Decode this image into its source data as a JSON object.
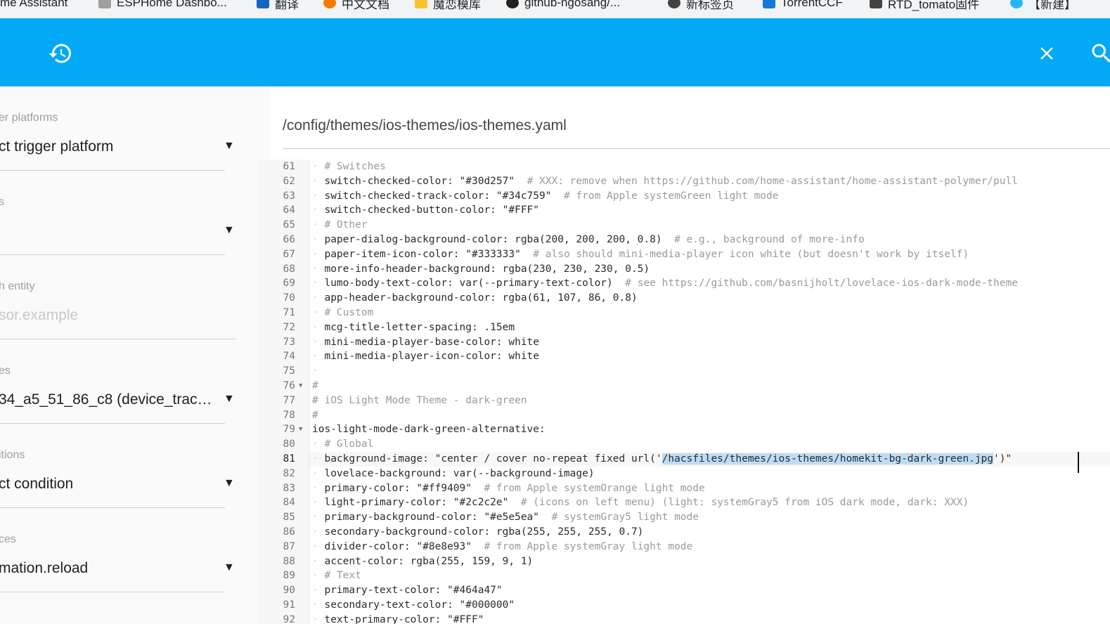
{
  "bookmarks": [
    {
      "label": "me Assistant",
      "color": "#03a9f4"
    },
    {
      "label": "ESPHome Dashbo...",
      "color": "#9e9e9e"
    },
    {
      "label": "翻译",
      "color": "#1565c0"
    },
    {
      "label": "中文文档",
      "color": "#f57c00"
    },
    {
      "label": "魔恋模库",
      "color": "#fbc02d"
    },
    {
      "label": "github-ngosang/...",
      "color": "#212121"
    },
    {
      "label": "新标签页",
      "color": "#424242"
    },
    {
      "label": "TorrentCCF",
      "color": "#1976d2"
    },
    {
      "label": "RTD_tomato固件",
      "color": "#424242"
    },
    {
      "label": "【新建】",
      "color": "#29b6f6"
    }
  ],
  "toolbar": {
    "color": "#03a9f4",
    "left_icon": "history-icon",
    "close_icon": "close-icon",
    "search_icon": "search-icon"
  },
  "form": {
    "fields": [
      {
        "label": "er platforms",
        "value": "ct trigger platform",
        "dropdown": true
      },
      {
        "label": "s",
        "value": "",
        "dropdown": true
      },
      {
        "label": "h entity",
        "value": "sor.example",
        "dropdown": false,
        "placeholder": true
      },
      {
        "label": "es",
        "value": "34_a5_51_86_c8 (device_tracke...",
        "dropdown": true
      },
      {
        "label": "itions",
        "value": "ct condition",
        "dropdown": true
      },
      {
        "label": "ces",
        "value": "mation.reload",
        "dropdown": true
      }
    ]
  },
  "editor": {
    "file_path": "/config/themes/ios-themes/ios-themes.yaml",
    "active_line": "81",
    "lines": [
      {
        "n": "61",
        "indent": 1,
        "text": "# Switches",
        "comment": true
      },
      {
        "n": "62",
        "indent": 1,
        "text": "switch-checked-color: \"#30d257\"",
        "tail": "# XXX: remove when https://github.com/home-assistant/home-assistant-polymer/pull"
      },
      {
        "n": "63",
        "indent": 1,
        "text": "switch-checked-track-color: \"#34c759\"",
        "tail": "# from Apple systemGreen light mode"
      },
      {
        "n": "64",
        "indent": 1,
        "text": "switch-checked-button-color: \"#FFF\""
      },
      {
        "n": "65",
        "indent": 1,
        "text": "# Other",
        "comment": true
      },
      {
        "n": "66",
        "indent": 1,
        "text": "paper-dialog-background-color: rgba(200, 200, 200, 0.8)",
        "tail": "# e.g., background of more-info"
      },
      {
        "n": "67",
        "indent": 1,
        "text": "paper-item-icon-color: \"#333333\"",
        "tail": "# also should mini-media-player icon white (but doesn't work by itself)"
      },
      {
        "n": "68",
        "indent": 1,
        "text": "more-info-header-background: rgba(230, 230, 230, 0.5)"
      },
      {
        "n": "69",
        "indent": 1,
        "text": "lumo-body-text-color: var(--primary-text-color)",
        "tail": "# see https://github.com/basnijholt/lovelace-ios-dark-mode-theme"
      },
      {
        "n": "70",
        "indent": 1,
        "text": "app-header-background-color: rgba(61, 107, 86, 0.8)"
      },
      {
        "n": "71",
        "indent": 1,
        "text": "# Custom",
        "comment": true
      },
      {
        "n": "72",
        "indent": 1,
        "text": "mcg-title-letter-spacing: .15em"
      },
      {
        "n": "73",
        "indent": 1,
        "text": "mini-media-player-base-color: white"
      },
      {
        "n": "74",
        "indent": 1,
        "text": "mini-media-player-icon-color: white"
      },
      {
        "n": "75",
        "indent": 1,
        "text": ""
      },
      {
        "n": "76",
        "indent": 0,
        "text": "#",
        "comment": true,
        "fold": true
      },
      {
        "n": "77",
        "indent": 0,
        "text": "# iOS Light Mode Theme - dark-green",
        "comment": true
      },
      {
        "n": "78",
        "indent": 0,
        "text": "#",
        "comment": true
      },
      {
        "n": "79",
        "indent": 0,
        "text": "ios-light-mode-dark-green-alternative:",
        "fold": true
      },
      {
        "n": "80",
        "indent": 1,
        "text": "# Global",
        "comment": true
      },
      {
        "n": "81",
        "indent": 1,
        "text": "background-image: \"center / cover no-repeat fixed url('",
        "selected": "/hacsfiles/themes/ios-themes/homekit-bg-dark-green.jpg",
        "after": "')\""
      },
      {
        "n": "82",
        "indent": 1,
        "text": "lovelace-background: var(--background-image)"
      },
      {
        "n": "83",
        "indent": 1,
        "text": "primary-color: \"#ff9409\"",
        "tail": "# from Apple systemOrange light mode"
      },
      {
        "n": "84",
        "indent": 1,
        "text": "light-primary-color: \"#2c2c2e\"",
        "tail": "# (icons on left menu) (light: systemGray5 from iOS dark mode, dark: XXX)"
      },
      {
        "n": "85",
        "indent": 1,
        "text": "primary-background-color: \"#e5e5ea\"",
        "tail": "# systemGray5 light mode"
      },
      {
        "n": "86",
        "indent": 1,
        "text": "secondary-background-color: rgba(255, 255, 255, 0.7)"
      },
      {
        "n": "87",
        "indent": 1,
        "text": "divider-color: \"#8e8e93\"",
        "tail": "# from Apple systemGray light mode"
      },
      {
        "n": "88",
        "indent": 1,
        "text": "accent-color: rgba(255, 159, 9, 1)"
      },
      {
        "n": "89",
        "indent": 1,
        "text": "# Text",
        "comment": true
      },
      {
        "n": "90",
        "indent": 1,
        "text": "primary-text-color: \"#464a47\""
      },
      {
        "n": "91",
        "indent": 1,
        "text": "secondary-text-color: \"#000000\""
      },
      {
        "n": "92",
        "indent": 1,
        "text": "text-primary-color: \"#FFF\""
      }
    ]
  }
}
